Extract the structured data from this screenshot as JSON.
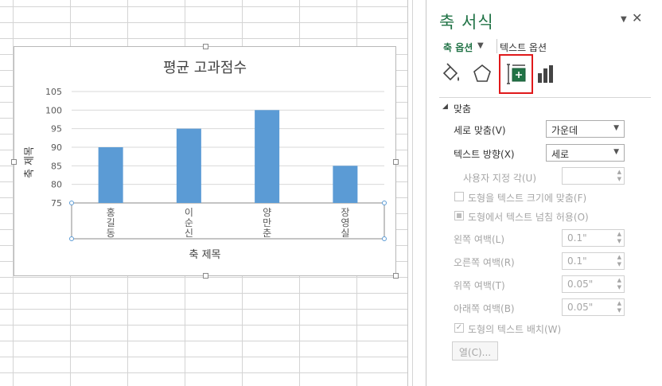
{
  "chart_data": {
    "type": "bar",
    "title": "평균 고과점수",
    "ylabel": "축 제목",
    "xlabel": "축 제목",
    "categories": [
      "홍길동",
      "이순신",
      "양만춘",
      "장영실"
    ],
    "values": [
      90,
      95,
      100,
      85
    ],
    "ylim": [
      75,
      105
    ],
    "yticks": [
      75,
      80,
      85,
      90,
      95,
      100,
      105
    ],
    "bar_color": "#5b9bd5",
    "grid": true,
    "category_label_orientation": "vertical"
  },
  "pane": {
    "title": "축 서식",
    "dropdown_icon": "triangle-down-icon",
    "close_icon": "close-icon",
    "tab_axis_options": "축 옵션",
    "tab_text_options": "텍스트 옵션",
    "icons": [
      "fill-line-icon",
      "effects-pentagon-icon",
      "size-properties-icon",
      "axis-options-icon"
    ],
    "section_title": "맞춤",
    "vertical_align_label": "세로 맞춤(V)",
    "vertical_align_value": "가운데",
    "text_direction_label": "텍스트 방향(X)",
    "text_direction_value": "세로",
    "custom_angle_label": "사용자 지정 각(U)",
    "custom_angle_value": "",
    "resize_label": "도형을 텍스트 크기에 맞춤(F)",
    "overflow_label": "도형에서 텍스트 넘침 허용(O)",
    "left_margin_label": "왼쪽 여백(L)",
    "left_margin_value": "0.1\"",
    "right_margin_label": "오른쪽 여백(R)",
    "right_margin_value": "0.1\"",
    "top_margin_label": "위쪽 여백(T)",
    "top_margin_value": "0.05\"",
    "bottom_margin_label": "아래쪽 여백(B)",
    "bottom_margin_value": "0.05\"",
    "wrap_label": "도형의 텍스트 배치(W)",
    "columns_button": "열(C)...",
    "accent_color": "#217346",
    "highlight_color": "#e0191b"
  }
}
